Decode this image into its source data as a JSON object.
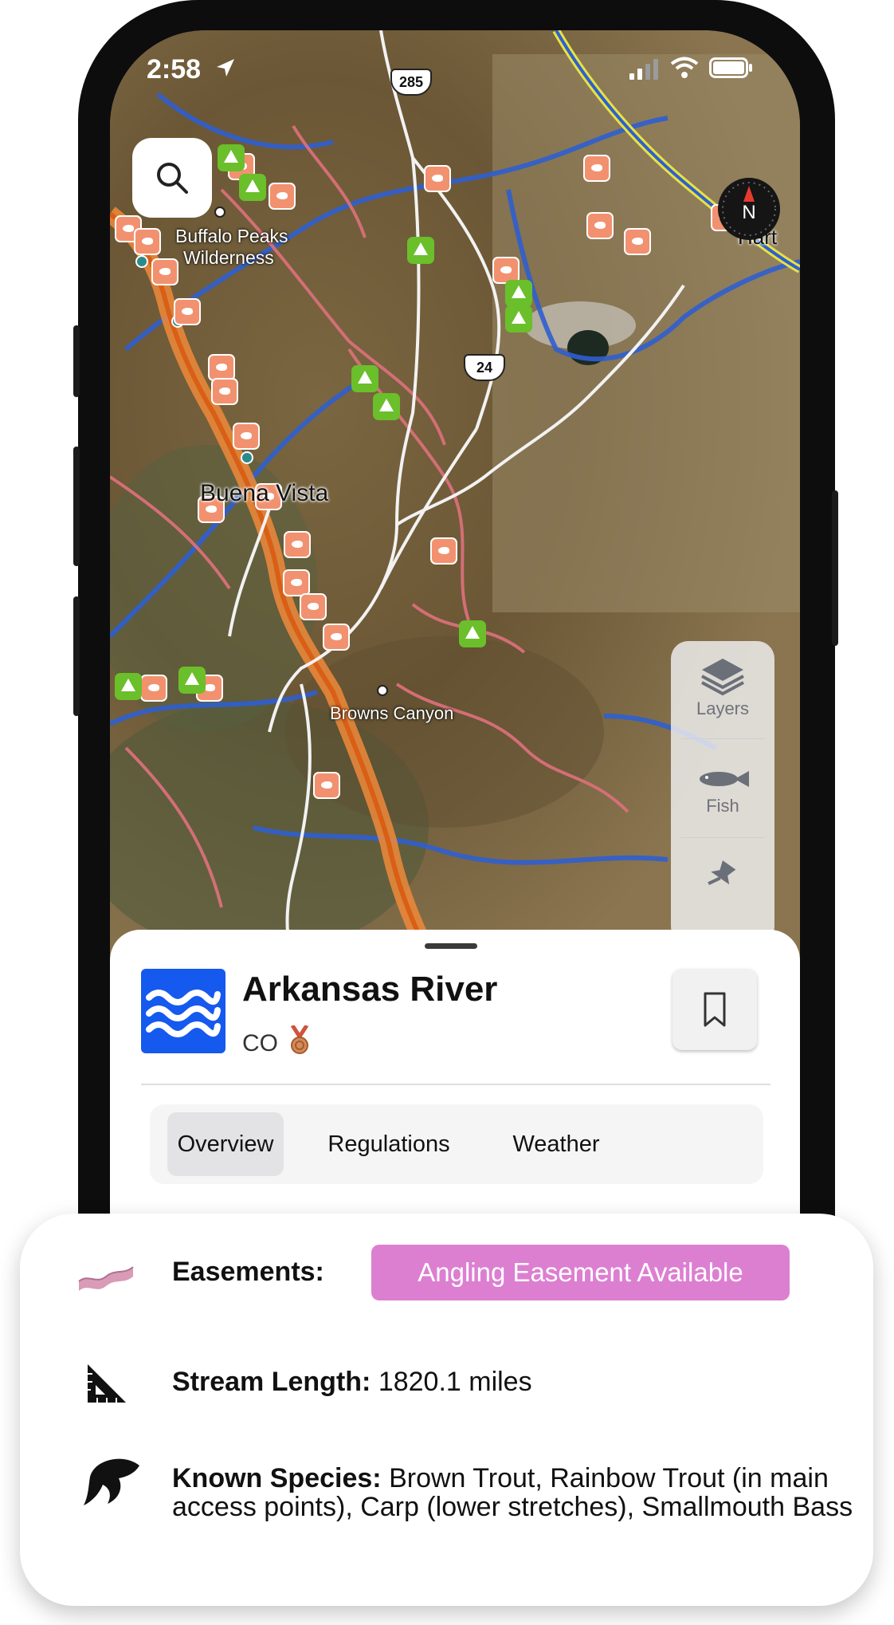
{
  "status_bar": {
    "time": "2:58"
  },
  "map": {
    "place_labels": [
      "Buffalo Peaks",
      "Wilderness",
      "Buena Vista",
      "Browns Canyon",
      "Hart"
    ],
    "highway_shields": [
      "285",
      "24"
    ],
    "compass_letter": "N",
    "layers_panel": {
      "layers_label": "Layers",
      "fish_label": "Fish"
    }
  },
  "sheet": {
    "title": "Arkansas River",
    "state": "CO",
    "tabs": [
      {
        "label": "Overview",
        "active": true
      },
      {
        "label": "Regulations",
        "active": false
      },
      {
        "label": "Weather",
        "active": false
      }
    ]
  },
  "details": {
    "easements_label": "Easements:",
    "easements_badge": "Angling Easement Available",
    "stream_length_label": "Stream Length:",
    "stream_length_value": "1820.1 miles",
    "species_label": "Known Species:",
    "species_value": "Brown Trout, Rainbow Trout (in main access points), Carp (lower stretches), Smallmouth Bass"
  },
  "colors": {
    "river_blue": "#1659ee",
    "easement_pink": "#dc7fd1",
    "camp_green": "#6abf2a",
    "access_orange": "#f2916f"
  },
  "icons": [
    "search-icon",
    "compass-icon",
    "layers-icon",
    "fish-icon",
    "pin-icon",
    "waves-icon",
    "bookmark-icon",
    "medal-icon",
    "easement-icon",
    "ruler-icon",
    "fish-silhouette-icon",
    "location-arrow-icon",
    "signal-icon",
    "wifi-icon",
    "battery-icon"
  ]
}
